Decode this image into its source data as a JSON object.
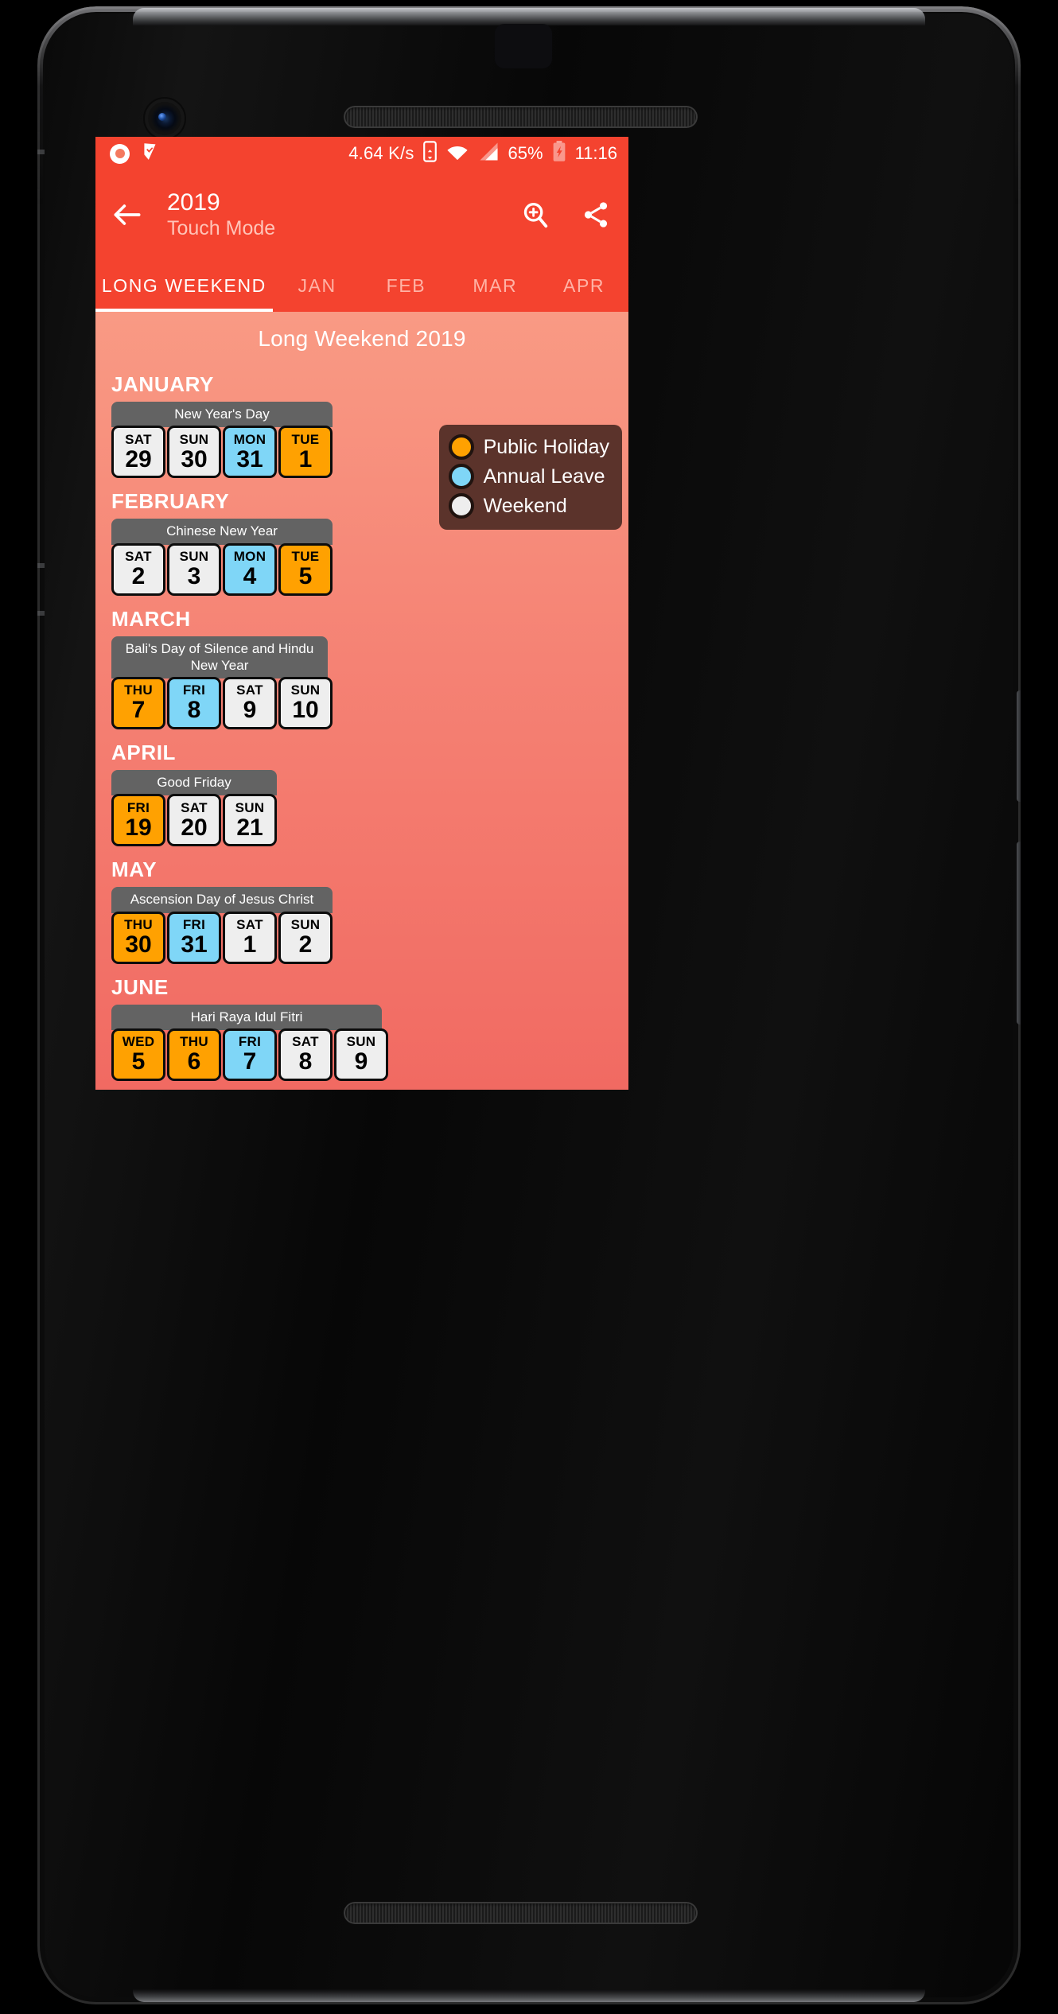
{
  "status_bar": {
    "record_icon": "record-icon",
    "notification_icon": "checkmark-flag-icon",
    "net_speed": "4.64 K/s",
    "vibrate_icon": "phone-vibrate-icon",
    "wifi_icon": "wifi-icon",
    "signal_icon": "cellular-signal-icon",
    "battery_percent": "65%",
    "battery_icon": "battery-charging-icon",
    "clock": "11:16"
  },
  "app_bar": {
    "back_icon": "back-arrow-icon",
    "title": "2019",
    "subtitle": "Touch Mode",
    "zoom_icon": "zoom-in-icon",
    "share_icon": "share-icon"
  },
  "tabs": [
    {
      "label": "LONG WEEKEND",
      "active": true
    },
    {
      "label": "JAN",
      "active": false
    },
    {
      "label": "FEB",
      "active": false
    },
    {
      "label": "MAR",
      "active": false
    },
    {
      "label": "APR",
      "active": false
    }
  ],
  "content": {
    "title": "Long Weekend 2019"
  },
  "legend": {
    "items": [
      {
        "label": "Public Holiday",
        "color": "#ffa101",
        "icon": "legend-dot-public-holiday"
      },
      {
        "label": "Annual Leave",
        "color": "#7fd6f7",
        "icon": "legend-dot-annual-leave"
      },
      {
        "label": "Weekend",
        "color": "#eeeeee",
        "icon": "legend-dot-weekend"
      }
    ]
  },
  "colors": {
    "brand_red": "#f4432f",
    "content_top": "#f99a84",
    "content_bottom": "#f16a62",
    "public_holiday": "#ffa101",
    "annual_leave": "#7fd6f7",
    "weekend": "#eeeeee",
    "label_gray": "#636363",
    "legend_bg": "#5b332b"
  },
  "months": [
    {
      "name": "JANUARY",
      "holiday": "New Year's Day",
      "days": [
        {
          "dow": "SAT",
          "num": "29",
          "type": "weekend"
        },
        {
          "dow": "SUN",
          "num": "30",
          "type": "weekend"
        },
        {
          "dow": "MON",
          "num": "31",
          "type": "leave"
        },
        {
          "dow": "TUE",
          "num": "1",
          "type": "holiday"
        }
      ]
    },
    {
      "name": "FEBRUARY",
      "holiday": "Chinese New Year",
      "days": [
        {
          "dow": "SAT",
          "num": "2",
          "type": "weekend"
        },
        {
          "dow": "SUN",
          "num": "3",
          "type": "weekend"
        },
        {
          "dow": "MON",
          "num": "4",
          "type": "leave"
        },
        {
          "dow": "TUE",
          "num": "5",
          "type": "holiday"
        }
      ]
    },
    {
      "name": "MARCH",
      "holiday": "Bali's Day of Silence and Hindu New Year",
      "days": [
        {
          "dow": "THU",
          "num": "7",
          "type": "holiday"
        },
        {
          "dow": "FRI",
          "num": "8",
          "type": "leave"
        },
        {
          "dow": "SAT",
          "num": "9",
          "type": "weekend"
        },
        {
          "dow": "SUN",
          "num": "10",
          "type": "weekend"
        }
      ]
    },
    {
      "name": "APRIL",
      "holiday": "Good Friday",
      "days": [
        {
          "dow": "FRI",
          "num": "19",
          "type": "holiday"
        },
        {
          "dow": "SAT",
          "num": "20",
          "type": "weekend"
        },
        {
          "dow": "SUN",
          "num": "21",
          "type": "weekend"
        }
      ]
    },
    {
      "name": "MAY",
      "holiday": "Ascension Day of Jesus Christ",
      "days": [
        {
          "dow": "THU",
          "num": "30",
          "type": "holiday"
        },
        {
          "dow": "FRI",
          "num": "31",
          "type": "leave"
        },
        {
          "dow": "SAT",
          "num": "1",
          "type": "weekend"
        },
        {
          "dow": "SUN",
          "num": "2",
          "type": "weekend"
        }
      ]
    },
    {
      "name": "JUNE",
      "holiday": "Hari Raya Idul Fitri",
      "days": [
        {
          "dow": "WED",
          "num": "5",
          "type": "holiday"
        },
        {
          "dow": "THU",
          "num": "6",
          "type": "holiday"
        },
        {
          "dow": "FRI",
          "num": "7",
          "type": "leave"
        },
        {
          "dow": "SAT",
          "num": "8",
          "type": "weekend"
        },
        {
          "dow": "SUN",
          "num": "9",
          "type": "weekend"
        }
      ]
    }
  ]
}
